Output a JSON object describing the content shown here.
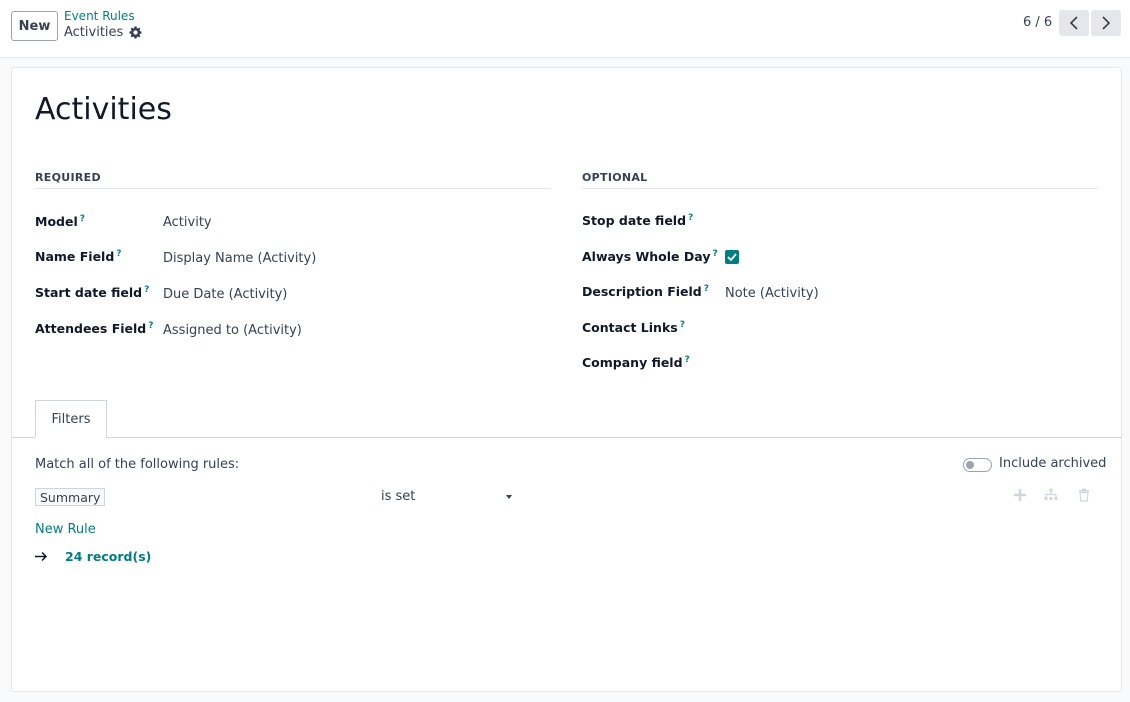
{
  "toolbar": {
    "new_label": "New",
    "breadcrumb_parent": "Event Rules",
    "breadcrumb_current": "Activities",
    "pager": "6 / 6"
  },
  "record": {
    "title": "Activities"
  },
  "required_group": {
    "title": "REQUIRED",
    "fields": [
      {
        "label": "Model",
        "help": "?",
        "value": "Activity"
      },
      {
        "label": "Name Field",
        "help": "?",
        "value": "Display Name (Activity)"
      },
      {
        "label": "Start date field",
        "help": "?",
        "value": "Due Date (Activity)"
      },
      {
        "label": "Attendees Field",
        "help": "?",
        "value": "Assigned to (Activity)"
      }
    ]
  },
  "optional_group": {
    "title": "OPTIONAL",
    "fields": [
      {
        "label": "Stop date field",
        "help": "?",
        "value": ""
      },
      {
        "label": "Always Whole Day",
        "help": "?",
        "checked": true
      },
      {
        "label": "Description Field",
        "help": "?",
        "value": "Note (Activity)"
      },
      {
        "label": "Contact Links",
        "help": "?",
        "value": ""
      },
      {
        "label": "Company field",
        "help": "?",
        "value": ""
      }
    ]
  },
  "tabs": [
    {
      "label": "Filters",
      "active": true
    }
  ],
  "filters": {
    "match_text": "Match all of the following rules:",
    "include_archived_label": "Include archived",
    "include_archived": false,
    "rules": [
      {
        "field": "Summary",
        "operator": "is set"
      }
    ],
    "new_rule_label": "New Rule",
    "records_link": "24 record(s)"
  },
  "colors": {
    "accent": "#017e84",
    "text": "#374151",
    "border": "#e5e7eb"
  },
  "icons": {
    "settings": "gear-icon",
    "prev": "chevron-left-icon",
    "next": "chevron-right-icon",
    "add_rule": "plus-icon",
    "add_branch": "sitemap-icon",
    "delete_rule": "trash-icon",
    "records": "arrow-right-icon"
  }
}
